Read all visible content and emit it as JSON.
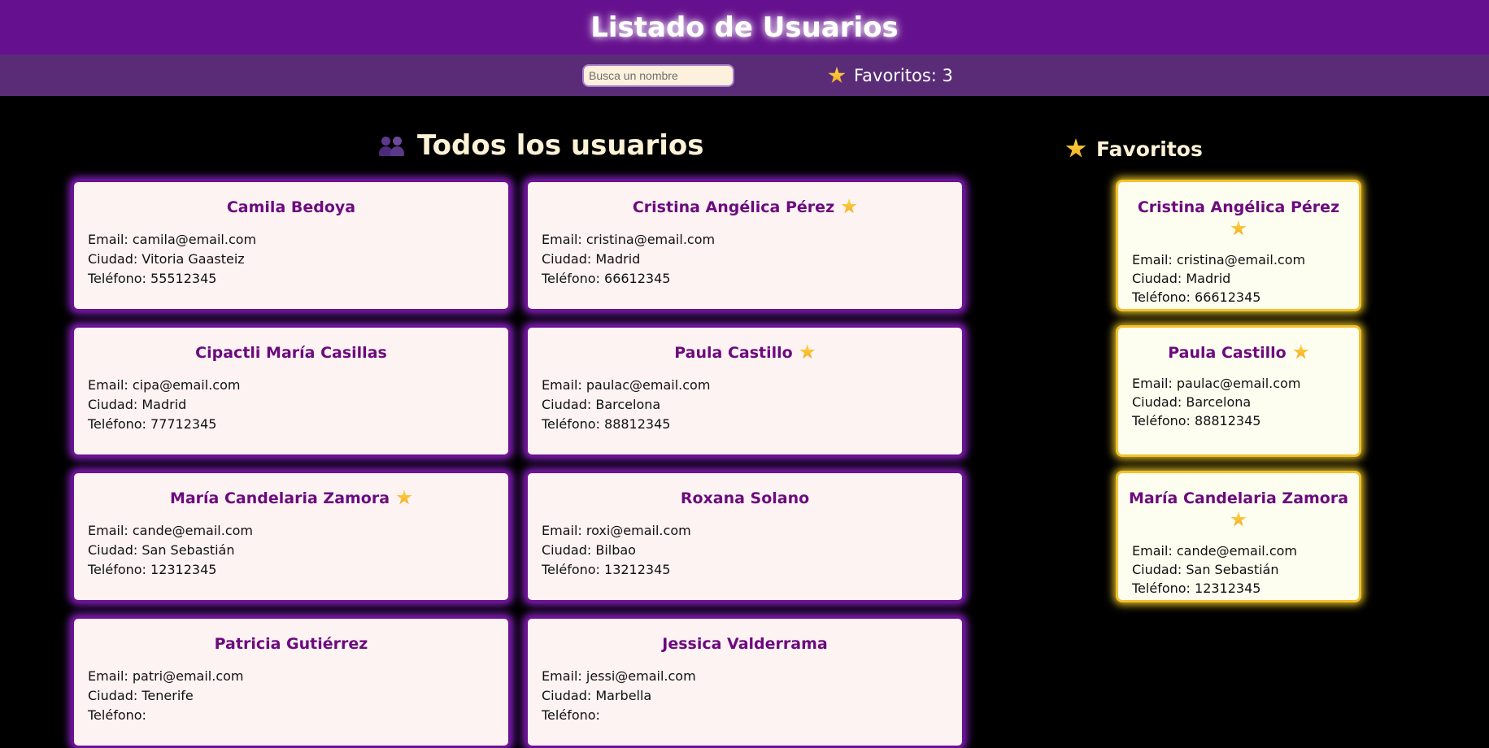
{
  "header": {
    "title": "Listado de Usuarios"
  },
  "toolbar": {
    "search_placeholder": "Busca un nombre",
    "search_value": "",
    "favorites_count_label": "Favoritos: 3"
  },
  "sections": {
    "all_title": "Todos los usuarios",
    "favorites_title": "Favoritos"
  },
  "labels": {
    "email": "Email: ",
    "city": "Ciudad: ",
    "phone": "Teléfono: "
  },
  "users": [
    {
      "name": "Camila Bedoya",
      "email": "camila@email.com",
      "city": "Vitoria Gaasteiz",
      "phone": "55512345",
      "favorite": false
    },
    {
      "name": "Cristina Angélica Pérez",
      "email": "cristina@email.com",
      "city": "Madrid",
      "phone": "66612345",
      "favorite": true
    },
    {
      "name": "Cipactli María Casillas",
      "email": "cipa@email.com",
      "city": "Madrid",
      "phone": "77712345",
      "favorite": false
    },
    {
      "name": "Paula Castillo",
      "email": "paulac@email.com",
      "city": "Barcelona",
      "phone": "88812345",
      "favorite": true
    },
    {
      "name": "María Candelaria Zamora",
      "email": "cande@email.com",
      "city": "San Sebastián",
      "phone": "12312345",
      "favorite": true
    },
    {
      "name": "Roxana Solano",
      "email": "roxi@email.com",
      "city": "Bilbao",
      "phone": "13212345",
      "favorite": false
    },
    {
      "name": "Patricia Gutiérrez",
      "email": "patri@email.com",
      "city": "Tenerife",
      "phone": "",
      "favorite": false
    },
    {
      "name": "Jessica Valderrama",
      "email": "jessi@email.com",
      "city": "Marbella",
      "phone": "",
      "favorite": false
    }
  ],
  "favorites": [
    {
      "name": "Cristina Angélica Pérez",
      "email": "cristina@email.com",
      "city": "Madrid",
      "phone": "66612345"
    },
    {
      "name": "Paula Castillo",
      "email": "paulac@email.com",
      "city": "Barcelona",
      "phone": "88812345"
    },
    {
      "name": "María Candelaria Zamora",
      "email": "cande@email.com",
      "city": "San Sebastián",
      "phone": "12312345"
    }
  ],
  "colors": {
    "header_bg": "#65108e",
    "subbar_bg": "#5a2c78",
    "card_border": "#6c1194",
    "fav_border": "#f2c12e",
    "name_color": "#6c0a7e"
  }
}
